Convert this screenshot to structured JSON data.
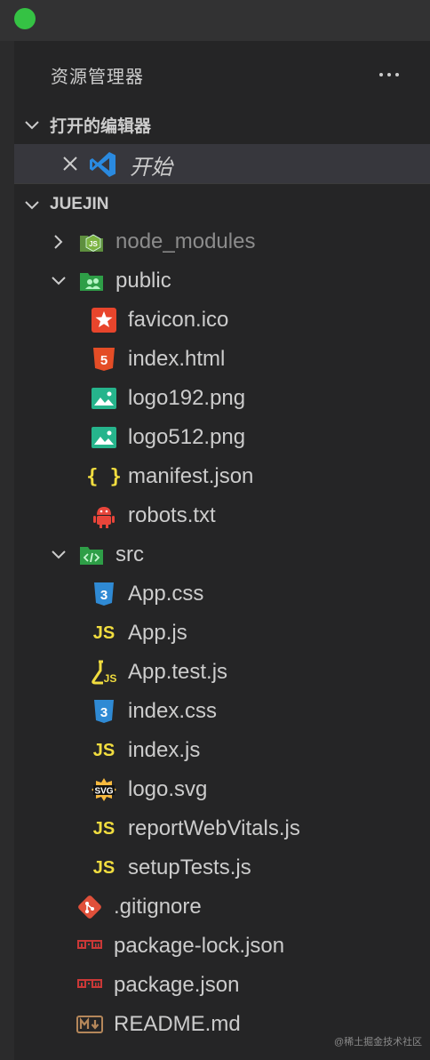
{
  "explorer": {
    "title": "资源管理器",
    "more_icon": "ellipsis-icon",
    "open_editors": {
      "label": "打开的编辑器",
      "items": [
        {
          "name": "开始",
          "icon": "vscode-logo-icon"
        }
      ]
    },
    "project": {
      "label": "JUEJIN",
      "tree": [
        {
          "name": "node_modules",
          "type": "folder",
          "expanded": false,
          "icon": "nodejs-folder-icon"
        },
        {
          "name": "public",
          "type": "folder",
          "expanded": true,
          "icon": "public-folder-icon"
        },
        {
          "name": "favicon.ico",
          "icon": "favicon-star-icon"
        },
        {
          "name": "index.html",
          "icon": "html5-icon"
        },
        {
          "name": "logo192.png",
          "icon": "image-icon"
        },
        {
          "name": "logo512.png",
          "icon": "image-icon"
        },
        {
          "name": "manifest.json",
          "icon": "json-braces-icon"
        },
        {
          "name": "robots.txt",
          "icon": "robot-icon"
        },
        {
          "name": "src",
          "type": "folder",
          "expanded": true,
          "icon": "src-folder-icon"
        },
        {
          "name": "App.css",
          "icon": "css3-icon"
        },
        {
          "name": "App.js",
          "icon": "js-icon"
        },
        {
          "name": "App.test.js",
          "icon": "test-js-icon"
        },
        {
          "name": "index.css",
          "icon": "css3-icon"
        },
        {
          "name": "index.js",
          "icon": "js-icon"
        },
        {
          "name": "logo.svg",
          "icon": "svg-icon"
        },
        {
          "name": "reportWebVitals.js",
          "icon": "js-icon"
        },
        {
          "name": "setupTests.js",
          "icon": "js-icon"
        },
        {
          "name": ".gitignore",
          "icon": "git-icon"
        },
        {
          "name": "package-lock.json",
          "icon": "npm-icon"
        },
        {
          "name": "package.json",
          "icon": "npm-icon"
        },
        {
          "name": "README.md",
          "icon": "markdown-icon"
        }
      ]
    }
  },
  "watermark": "@稀土掘金技术社区",
  "colors": {
    "js": "#f1dd3f",
    "css": "#2f8ad4",
    "html": "#e44d26",
    "image": "#26b48c",
    "npm": "#cb3837",
    "git": "#e0503a",
    "node": "#6ca64b"
  }
}
